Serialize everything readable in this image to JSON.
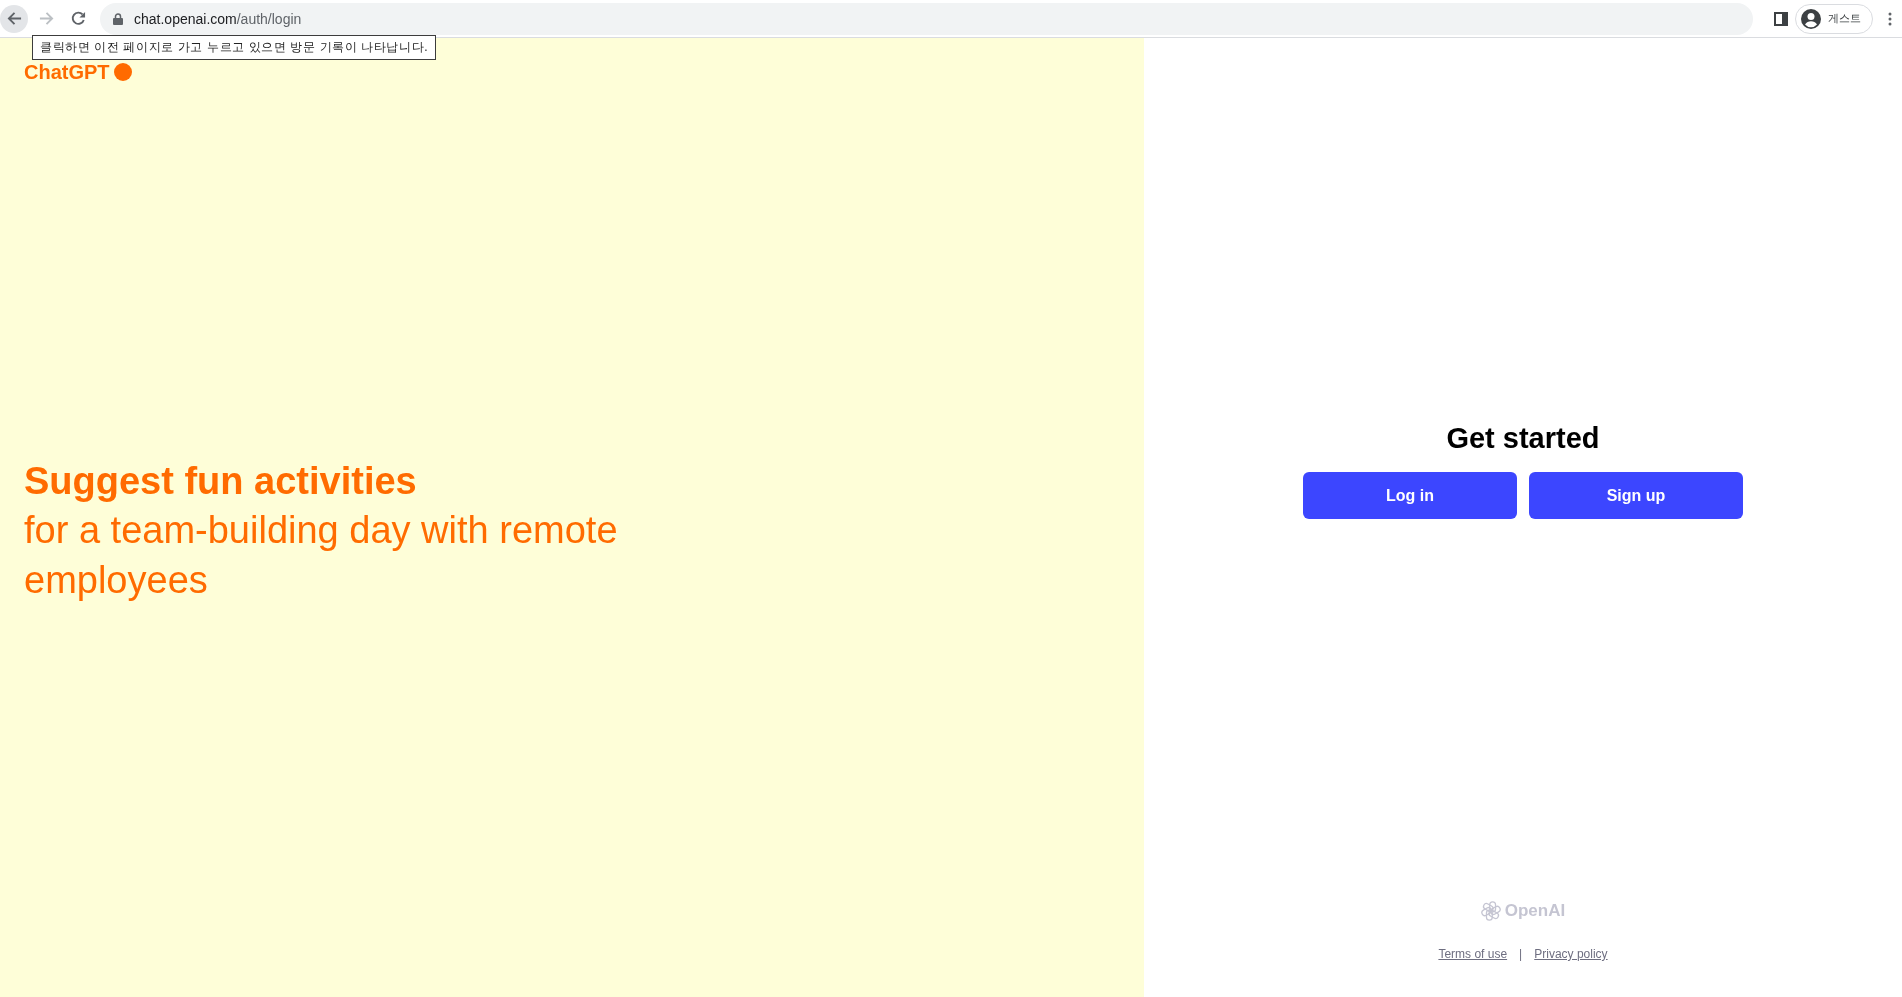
{
  "browser": {
    "nav_buttons": [
      {
        "kind": "back",
        "disabled": false,
        "hovered": true
      },
      {
        "kind": "forward",
        "disabled": true,
        "hovered": false
      },
      {
        "kind": "reload",
        "disabled": false,
        "hovered": false
      }
    ],
    "url_host": "chat.openai.com",
    "url_path": "/auth/login",
    "profile_label": "게스트",
    "tooltip": "클릭하면 이전 페이지로 가고 누르고 있으면 방문 기록이 나타납니다."
  },
  "brand": {
    "name": "ChatGPT"
  },
  "prompt": {
    "title": "Suggest fun activities",
    "text": "for a team-building day with remote employees"
  },
  "auth": {
    "heading": "Get started",
    "buttons": [
      "Log in",
      "Sign up"
    ]
  },
  "footer": {
    "logo_text": "OpenAI",
    "links": [
      "Terms of use",
      "Privacy policy"
    ],
    "separator": "|"
  }
}
